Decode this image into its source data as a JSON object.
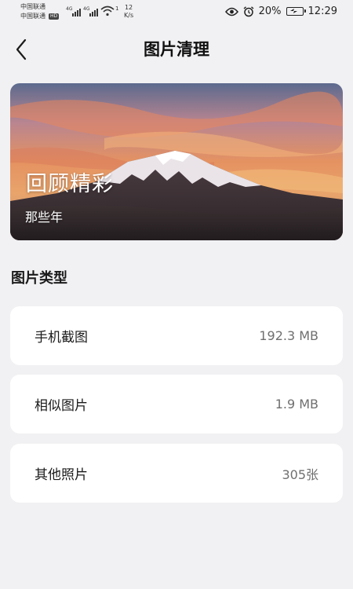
{
  "status_bar": {
    "carrier_1": "中国联通",
    "carrier_2": "中国联通",
    "hd_badge": "HD",
    "signal_1_tag": "4G",
    "signal_2_tag": "4G",
    "wifi_badge": "1",
    "speed_value": "12",
    "speed_unit": "K/s",
    "battery_percent": "20%",
    "time": "12:29",
    "icons": [
      "eye-icon",
      "alarm-icon",
      "battery-charging-icon",
      "wifi-icon",
      "signal-icon"
    ]
  },
  "header": {
    "title": "图片清理",
    "back_icon": "chevron-left-icon"
  },
  "banner": {
    "title": "回顾精彩",
    "subtitle": "那些年"
  },
  "section": {
    "title": "图片类型"
  },
  "categories": [
    {
      "name": "手机截图",
      "value": "192.3 MB"
    },
    {
      "name": "相似图片",
      "value": "1.9 MB"
    },
    {
      "name": "其他照片",
      "value": "305张"
    }
  ],
  "colors": {
    "background": "#f1f1f3",
    "card": "#ffffff",
    "text_primary": "#1b1b1b",
    "text_secondary": "#6f6f6f"
  }
}
